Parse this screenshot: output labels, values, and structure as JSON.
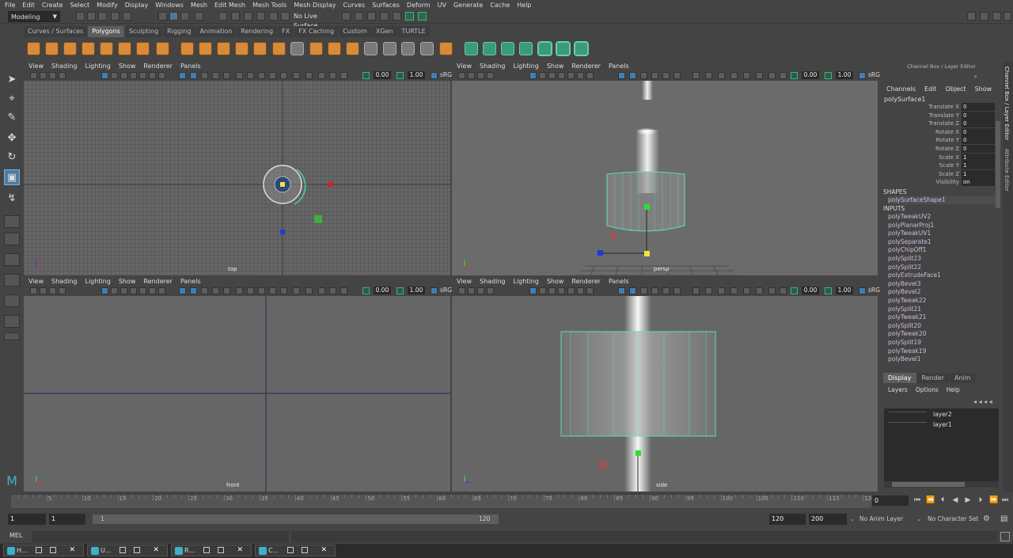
{
  "menubar": [
    "File",
    "Edit",
    "Create",
    "Select",
    "Modify",
    "Display",
    "Windows",
    "Mesh",
    "Edit Mesh",
    "Mesh Tools",
    "Mesh Display",
    "Curves",
    "Surfaces",
    "Deform",
    "UV",
    "Generate",
    "Cache",
    "Help"
  ],
  "status": {
    "mode": "Modeling",
    "live_surface": "No Live Surface"
  },
  "shelf_tabs": [
    "Curves / Surfaces",
    "Polygons",
    "Sculpting",
    "Rigging",
    "Animation",
    "Rendering",
    "FX",
    "FX Caching",
    "Custom",
    "XGen",
    "TURTLE"
  ],
  "shelf_active": "Polygons",
  "panel_menu": [
    "View",
    "Shading",
    "Lighting",
    "Show",
    "Renderer",
    "Panels"
  ],
  "panel_values": {
    "exposure": "0.00",
    "gamma": "1.00",
    "colorspace": "sRG"
  },
  "panel_values_persp": {
    "exposure": "0.00",
    "gamma": "1.00",
    "colorspace": "sRG"
  },
  "viewports": {
    "top": "top",
    "persp": "persp",
    "front": "front",
    "side": "side"
  },
  "channel_box": {
    "header": "Channel Box / Layer Editor",
    "menu": [
      "Channels",
      "Edit",
      "Object",
      "Show"
    ],
    "object": "polySurface1",
    "attrs": [
      {
        "name": "Translate X",
        "value": "0"
      },
      {
        "name": "Translate Y",
        "value": "0"
      },
      {
        "name": "Translate Z",
        "value": "0"
      },
      {
        "name": "Rotate X",
        "value": "0"
      },
      {
        "name": "Rotate Y",
        "value": "0"
      },
      {
        "name": "Rotate Z",
        "value": "0"
      },
      {
        "name": "Scale X",
        "value": "1"
      },
      {
        "name": "Scale Y",
        "value": "1"
      },
      {
        "name": "Scale Z",
        "value": "1"
      },
      {
        "name": "Visibility",
        "value": "on"
      }
    ],
    "shapes_label": "SHAPES",
    "shape": "polySurfaceShape1",
    "inputs_label": "INPUTS",
    "inputs": [
      "polyTweakUV2",
      "polyPlanarProj1",
      "polyTweakUV1",
      "polySeparate1",
      "polyChipOff1",
      "polySplit23",
      "polySplit22",
      "polyExtrudeFace1",
      "polyBevel3",
      "polyBevel2",
      "polyTweak22",
      "polySplit21",
      "polyTweak21",
      "polySplit20",
      "polyTweak20",
      "polySplit19",
      "polyTweak19",
      "polyBevel1"
    ]
  },
  "layer_editor": {
    "tabs": [
      "Display",
      "Render",
      "Anim"
    ],
    "active_tab": "Display",
    "menu": [
      "Layers",
      "Options",
      "Help"
    ],
    "layers": [
      "layer2",
      "layer1"
    ]
  },
  "side_tabs": [
    "Channel Box / Layer Editor",
    "Attribute Editor"
  ],
  "timeline": {
    "ticks": [
      "5",
      "10",
      "15",
      "20",
      "25",
      "30",
      "35",
      "40",
      "45",
      "50",
      "55",
      "60",
      "65",
      "70",
      "75",
      "80",
      "85",
      "90",
      "95",
      "100",
      "105",
      "110",
      "115",
      "120"
    ],
    "current": "0"
  },
  "range": {
    "start": "1",
    "start2": "1",
    "bar_start": "1",
    "bar_end": "120",
    "end": "120",
    "end2": "200",
    "anim_layer": "No Anim Layer",
    "char_set": "No Character Set"
  },
  "cmd": {
    "label": "MEL"
  },
  "taskbar": [
    "H...",
    "U...",
    "R...",
    "C..."
  ]
}
